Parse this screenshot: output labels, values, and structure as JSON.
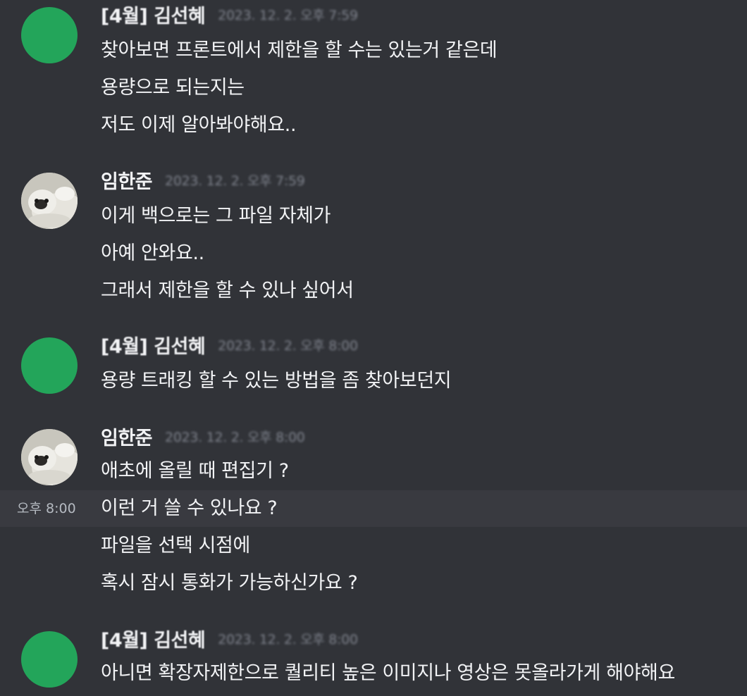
{
  "groups": [
    {
      "author": "[4월] 김선혜",
      "timestamp": "2023. 12. 2. 오후 7:59",
      "avatar": "green-avatar",
      "lines": [
        "찾아보면 프론트에서 제한을 할 수는 있는거 같은데",
        "용량으로 되는지는",
        "저도 이제 알아봐야해요.."
      ]
    },
    {
      "author": "임한준",
      "timestamp": "2023. 12. 2. 오후 7:59",
      "avatar": "photo-avatar",
      "lines": [
        "이게 백으로는 그 파일 자체가",
        "아예 안와요..",
        "그래서 제한을 할 수 있나 싶어서"
      ]
    },
    {
      "author": "[4월] 김선혜",
      "timestamp": "2023. 12. 2. 오후 8:00",
      "avatar": "green-avatar",
      "lines": [
        "용량 트래킹 할 수 있는 방법을 좀 찾아보던지"
      ]
    },
    {
      "author": "임한준",
      "timestamp": "2023. 12. 2. 오후 8:00",
      "avatar": "photo-avatar",
      "lines": [
        "애초에 올릴 때 편집기 ?",
        "이런 거 쓸 수 있나요 ?",
        "파일을 선택 시점에",
        "혹시 잠시 통화가 가능하신가요 ?"
      ],
      "hover_time": "오후 8:00"
    },
    {
      "author": "[4월] 김선혜",
      "timestamp": "2023. 12. 2. 오후 8:00",
      "avatar": "green-avatar",
      "lines": [
        "아니면 확장자제한으로 퀄리티 높은 이미지나 영상은 못올라가게 해야해요"
      ]
    }
  ],
  "colors": {
    "background": "#313338",
    "hover_row": "#393a40",
    "avatar_green": "#23a55a",
    "text": "#f2f3f5",
    "timestamp": "#80848e"
  }
}
